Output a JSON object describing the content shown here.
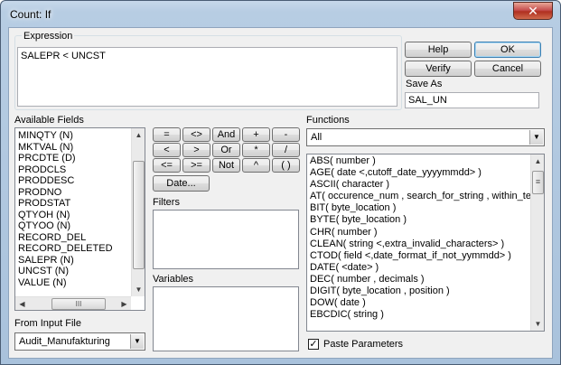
{
  "window": {
    "title": "Count: If"
  },
  "expression": {
    "group_label": "Expression",
    "value": "SALEPR < UNCST"
  },
  "buttons": {
    "help": "Help",
    "ok": "OK",
    "verify": "Verify",
    "cancel": "Cancel",
    "date": "Date..."
  },
  "save_as": {
    "label": "Save As",
    "value": "SAL_UN"
  },
  "available_fields": {
    "label": "Available Fields",
    "items": [
      "MINQTY  (N)",
      "MKTVAL  (N)",
      "PRCDTE  (D)",
      "PRODCLS",
      "PRODDESC",
      "PRODNO",
      "PRODSTAT",
      "QTYOH  (N)",
      "QTYOO  (N)",
      "RECORD_DEL",
      "RECORD_DELETED",
      "SALEPR  (N)",
      "UNCST  (N)",
      "VALUE  (N)"
    ]
  },
  "operators": [
    [
      "=",
      "<>",
      "And",
      "+",
      "-"
    ],
    [
      "<",
      ">",
      "Or",
      "*",
      "/"
    ],
    [
      "<=",
      ">=",
      "Not",
      "^",
      "( )"
    ]
  ],
  "filters": {
    "label": "Filters"
  },
  "variables": {
    "label": "Variables"
  },
  "functions": {
    "label": "Functions",
    "filter_value": "All",
    "items": [
      "ABS( number )",
      "AGE( date <,cutoff_date_yyyymmdd> )",
      "ASCII( character )",
      "AT( occurence_num , search_for_string , within_tex",
      "BIT( byte_location )",
      "BYTE( byte_location )",
      "CHR( number )",
      "CLEAN( string <,extra_invalid_characters> )",
      "CTOD( field <,date_format_if_not_yymmdd> )",
      "DATE( <date> )",
      "DEC( number , decimals )",
      "DIGIT( byte_location , position )",
      "DOW( date )",
      "EBCDIC( string )"
    ]
  },
  "input_file": {
    "label": "From Input File",
    "value": "Audit_Manufakturing"
  },
  "paste_parameters": {
    "label": "Paste Parameters",
    "checked": true,
    "mark": "✓"
  },
  "icons": {
    "close": "✕",
    "arrow_up": "▲",
    "arrow_down": "▼",
    "arrow_left": "◀",
    "arrow_right": "▶",
    "dropdown": "▼",
    "grip": "III",
    "grip_v": "≡"
  }
}
